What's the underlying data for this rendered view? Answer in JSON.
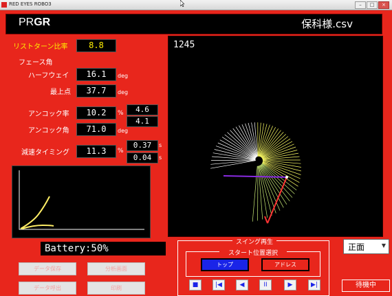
{
  "window": {
    "title": "RED EYES ROBO3",
    "controls": {
      "minimize": "–",
      "maximize": "□",
      "close": "×"
    }
  },
  "header": {
    "brand_light": "PR",
    "brand_bold": "GR",
    "filename": "保科様.csv"
  },
  "metrics": {
    "wrist_turn_ratio": {
      "label": "リストターン比率",
      "value": "8.8"
    },
    "face_angle": {
      "label": "フェース角"
    },
    "halfway": {
      "label": "ハーフウェイ",
      "value": "16.1",
      "unit": "deg"
    },
    "top_point": {
      "label": "最上点",
      "value": "37.7",
      "unit": "deg"
    },
    "uncock_rate": {
      "label": "アンコック率",
      "value": "10.2",
      "unit": "%",
      "sub1": "4.6",
      "sub2": "4.1"
    },
    "uncock_angle": {
      "label": "アンコック角",
      "value": "71.0",
      "unit": "deg"
    },
    "decel_timing": {
      "label": "減速タイミング",
      "value": "11.3",
      "unit": "%",
      "sub1": "0.37",
      "sub2": "0.04",
      "sub_unit": "s"
    }
  },
  "main_view": {
    "counter": "1245"
  },
  "battery": "Battery:50%",
  "gray_buttons": {
    "data_save": "データ保存",
    "analysis_display": "分析画面",
    "data_read": "データ呼出",
    "print": "印刷"
  },
  "playback": {
    "title": "スイング再生",
    "start_title": "スタート位置選択",
    "top": "トップ",
    "address": "アドレス",
    "controls": [
      "■",
      "|◀",
      "◀",
      "II",
      "▶",
      "▶|"
    ]
  },
  "view_select": {
    "value": "正面"
  },
  "status": "待機中",
  "colors": {
    "background": "#e8261c",
    "accent": "#1a24e8",
    "label_yellow": "#ffee00"
  }
}
